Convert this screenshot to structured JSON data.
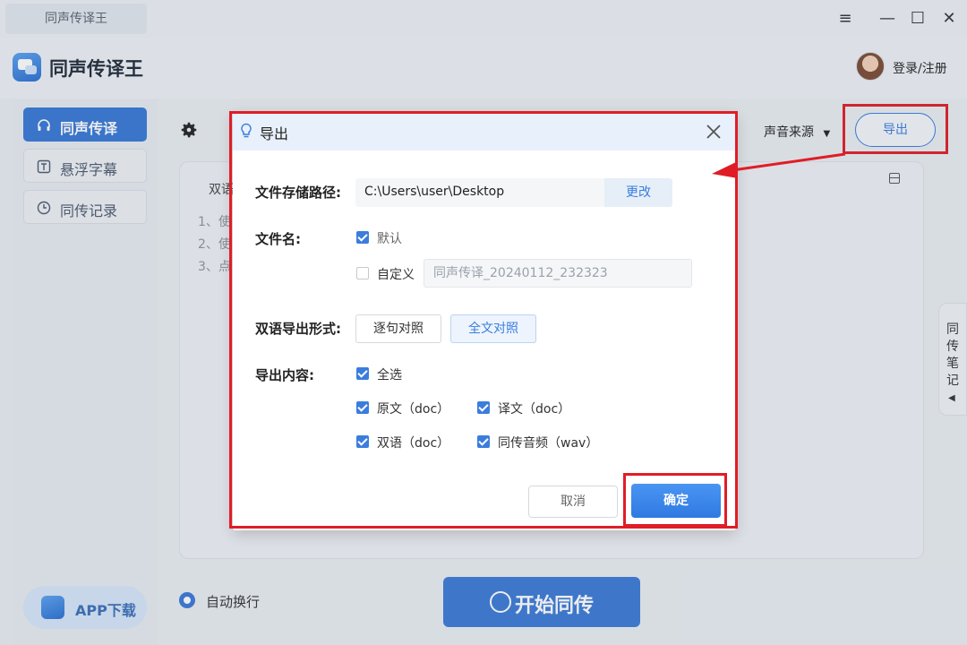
{
  "titlebar": {
    "tab_title": "同声传译王",
    "menu_icon": "≡",
    "minimize_icon": "—",
    "maximize_icon": "☐",
    "close_icon": "✕"
  },
  "header": {
    "app_name": "同声传译王",
    "login_label": "登录/注册"
  },
  "sidebar": {
    "items": [
      {
        "label": "同声传译",
        "icon": "headphones-icon",
        "active": true
      },
      {
        "label": "悬浮字幕",
        "icon": "caption-icon",
        "active": false
      },
      {
        "label": "同传记录",
        "icon": "clock-icon",
        "active": false
      }
    ],
    "app_download": "APP下载"
  },
  "main": {
    "voice_source": "声音来源",
    "voice_source_caret": "▼",
    "export_label": "导出",
    "content_tab": "双语",
    "hint_lines": [
      "1、使",
      "2、使",
      "3、点"
    ],
    "notes_tab": "同传笔记",
    "notes_arrow": "◀",
    "auto_wrap": "自动换行",
    "start_button": "开始同传"
  },
  "dialog": {
    "title": "导出",
    "path_label": "文件存储路径:",
    "path_value": "C:\\Users\\user\\Desktop",
    "change_label": "更改",
    "filename_label": "文件名:",
    "default_option": "默认",
    "custom_option": "自定义",
    "custom_filename_placeholder": "同声传译_20240112_232323",
    "bilingual_format_label": "双语导出形式:",
    "format_sentence": "逐句对照",
    "format_full": "全文对照",
    "content_label": "导出内容:",
    "select_all": "全选",
    "source_doc": "原文（doc）",
    "translation_doc": "译文（doc）",
    "bilingual_doc": "双语（doc）",
    "audio_wav": "同传音频（wav）",
    "cancel_label": "取消",
    "confirm_label": "确定"
  },
  "colors": {
    "accent": "#3b7ddd",
    "highlight": "#e01d26"
  }
}
